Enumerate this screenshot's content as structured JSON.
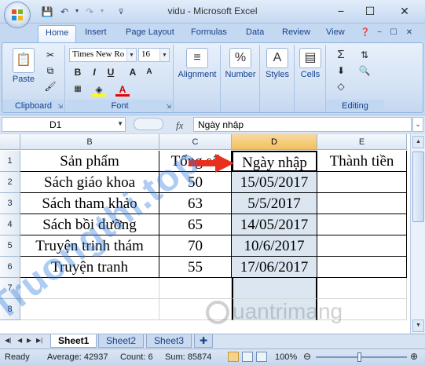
{
  "window": {
    "title": "vidu - Microsoft Excel",
    "minimize": "−",
    "maximize": "☐",
    "close": "✕"
  },
  "tabs": [
    "Home",
    "Insert",
    "Page Layout",
    "Formulas",
    "Data",
    "Review",
    "View"
  ],
  "ribbon": {
    "clipboard": {
      "label": "Clipboard",
      "paste": "Paste"
    },
    "font": {
      "label": "Font",
      "name": "Times New Ro",
      "size": "16",
      "bold": "B",
      "italic": "I",
      "underline": "U",
      "grow": "A",
      "shrink": "A"
    },
    "alignment": "Alignment",
    "number": {
      "label": "Number",
      "symbol": "%"
    },
    "styles": "Styles",
    "cells": "Cells",
    "editing": {
      "label": "Editing",
      "sigma": "Σ"
    }
  },
  "formula_bar": {
    "name_box": "D1",
    "fx": "fx",
    "content": "Ngày nhập"
  },
  "columns": [
    "B",
    "C",
    "D",
    "E"
  ],
  "rows": [
    {
      "num": "1",
      "b": "Sản phẩm",
      "c": "Tổng số",
      "d": "Ngày nhập",
      "e": "Thành tiền"
    },
    {
      "num": "2",
      "b": "Sách giáo khoa",
      "c": "50",
      "d": "15/05/2017",
      "e": ""
    },
    {
      "num": "3",
      "b": "Sách tham khảo",
      "c": "63",
      "d": "5/5/2017",
      "e": ""
    },
    {
      "num": "4",
      "b": "Sách bồi dưỡng",
      "c": "65",
      "d": "14/05/2017",
      "e": ""
    },
    {
      "num": "5",
      "b": "Truyện trinh thám",
      "c": "70",
      "d": "10/6/2017",
      "e": ""
    },
    {
      "num": "6",
      "b": "Truyện tranh",
      "c": "55",
      "d": "17/06/2017",
      "e": ""
    },
    {
      "num": "7",
      "b": "",
      "c": "",
      "d": "",
      "e": ""
    },
    {
      "num": "8",
      "b": "",
      "c": "",
      "d": "",
      "e": ""
    }
  ],
  "sheets": [
    "Sheet1",
    "Sheet2",
    "Sheet3"
  ],
  "status": {
    "ready": "Ready",
    "average": "Average: 42937",
    "count": "Count: 6",
    "sum": "Sum: 85874",
    "zoom": "100%"
  },
  "watermarks": {
    "left": "Truongthi.top",
    "right": "uantrimang"
  },
  "colors": {
    "arrow": "#e8301f",
    "selected_column": "#dce6f1",
    "header_selected": "#f1c15f"
  }
}
